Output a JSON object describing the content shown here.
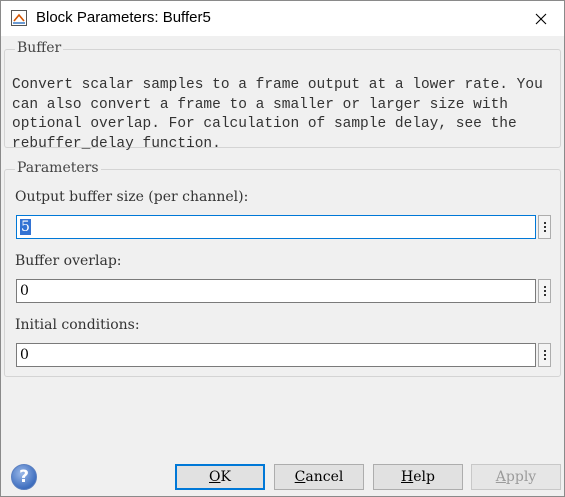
{
  "window": {
    "title": "Block Parameters: Buffer5"
  },
  "buffer_group": {
    "label": "Buffer",
    "description": "Convert scalar samples to a frame output at a lower rate. You\ncan also convert a frame to a smaller or larger size with\noptional overlap. For calculation of sample delay, see the\nrebuffer_delay function."
  },
  "parameters_group": {
    "label": "Parameters",
    "fields": [
      {
        "label": "Output buffer size (per channel):",
        "value": "5"
      },
      {
        "label": "Buffer overlap:",
        "value": "0"
      },
      {
        "label": "Initial conditions:",
        "value": "0"
      }
    ]
  },
  "buttons": {
    "ok": {
      "first": "O",
      "rest": "K"
    },
    "cancel": {
      "first": "C",
      "rest": "ancel"
    },
    "help": {
      "first": "H",
      "rest": "elp"
    },
    "apply": {
      "first": "A",
      "rest": "pply"
    }
  },
  "icons": {
    "app": "simulink-block-icon",
    "close": "close-icon",
    "help": "help-circle-icon",
    "menu": "kebab-menu-icon"
  }
}
